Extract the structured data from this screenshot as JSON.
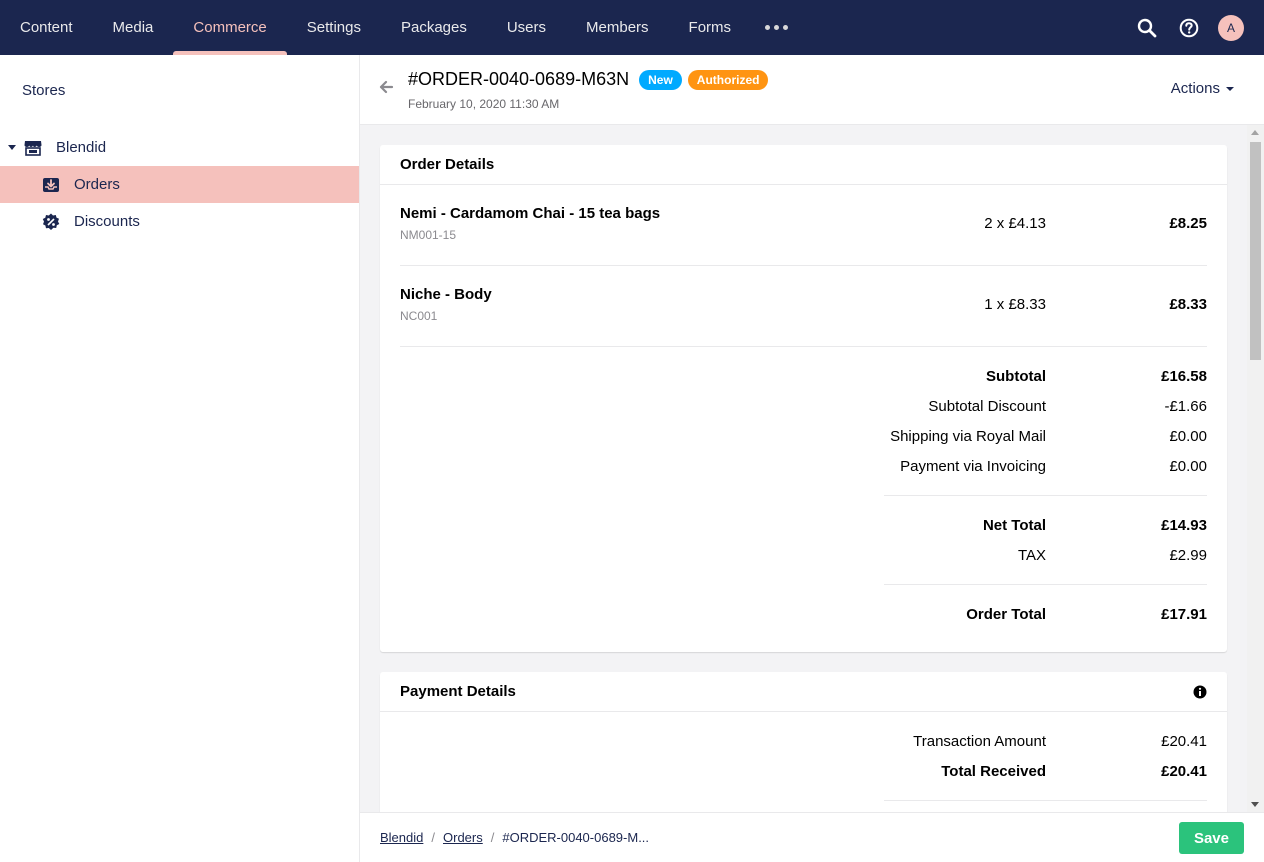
{
  "nav": {
    "items": [
      {
        "label": "Content"
      },
      {
        "label": "Media"
      },
      {
        "label": "Commerce"
      },
      {
        "label": "Settings"
      },
      {
        "label": "Packages"
      },
      {
        "label": "Users"
      },
      {
        "label": "Members"
      },
      {
        "label": "Forms"
      }
    ],
    "active": "Commerce",
    "avatar_initial": "A"
  },
  "sidebar": {
    "title": "Stores",
    "tree": {
      "root_label": "Blendid",
      "children": [
        {
          "label": "Orders",
          "icon": "inbox-download-icon",
          "selected": true
        },
        {
          "label": "Discounts",
          "icon": "discount-badge-icon",
          "selected": false
        }
      ]
    }
  },
  "header": {
    "order_number": "#ORDER-0040-0689-M63N",
    "badges": [
      {
        "label": "New",
        "color": "#00aaff"
      },
      {
        "label": "Authorized",
        "color": "#ff9412"
      }
    ],
    "date": "February 10, 2020 11:30 AM",
    "actions_label": "Actions"
  },
  "order_details": {
    "title": "Order Details",
    "items": [
      {
        "name": "Nemi - Cardamom Chai - 15 tea bags",
        "sku": "NM001-15",
        "qty_price": "2 x £4.13",
        "total": "£8.25"
      },
      {
        "name": "Niche - Body",
        "sku": "NC001",
        "qty_price": "1 x £8.33",
        "total": "£8.33"
      }
    ],
    "summary": {
      "subtotal_label": "Subtotal",
      "subtotal": "£16.58",
      "subtotal_discount_label": "Subtotal Discount",
      "subtotal_discount": "-£1.66",
      "shipping_label": "Shipping via Royal Mail",
      "shipping": "£0.00",
      "payment_label": "Payment via Invoicing",
      "payment": "£0.00",
      "net_total_label": "Net Total",
      "net_total": "£14.93",
      "tax_label": "TAX",
      "tax": "£2.99",
      "order_total_label": "Order Total",
      "order_total": "£17.91"
    }
  },
  "payment_details": {
    "title": "Payment Details",
    "transaction_amount_label": "Transaction Amount",
    "transaction_amount": "£20.41",
    "total_received_label": "Total Received",
    "total_received": "£20.41"
  },
  "footer": {
    "breadcrumb": [
      "Blendid",
      "Orders",
      "#ORDER-0040-0689-M..."
    ],
    "save_label": "Save"
  },
  "colors": {
    "nav_bg": "#1b264f",
    "accent_pink": "#f5c1bc",
    "save_green": "#2bc37c",
    "badge_new": "#00aaff",
    "badge_authorized": "#ff9412"
  }
}
